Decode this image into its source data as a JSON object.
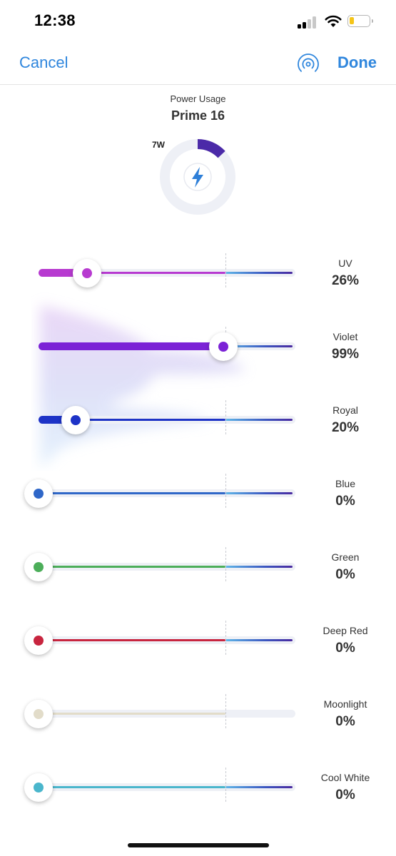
{
  "status_bar": {
    "time": "12:38"
  },
  "nav": {
    "cancel_label": "Cancel",
    "done_label": "Done",
    "broadcast_icon": "broadcast-icon"
  },
  "power": {
    "caption": "Power Usage",
    "device": "Prime 16",
    "watts_label": "7W",
    "ring_fraction": 0.13
  },
  "colors": {
    "accent": "#2f86dd",
    "ring_fill": "#4b2aa8",
    "ring_track": "#eef0f6"
  },
  "channels": [
    {
      "name": "UV",
      "value_label": "26%",
      "level": 0.26,
      "color": "#b73ad0"
    },
    {
      "name": "Violet",
      "value_label": "99%",
      "level": 0.99,
      "color": "#7b22d6"
    },
    {
      "name": "Royal",
      "value_label": "20%",
      "level": 0.2,
      "color": "#1d33c7"
    },
    {
      "name": "Blue",
      "value_label": "0%",
      "level": 0,
      "color": "#2f67c8"
    },
    {
      "name": "Green",
      "value_label": "0%",
      "level": 0,
      "color": "#4cae5a"
    },
    {
      "name": "Deep Red",
      "value_label": "0%",
      "level": 0,
      "color": "#c8253f"
    },
    {
      "name": "Moonlight",
      "value_label": "0%",
      "level": 0,
      "color": "#e2dcc9"
    },
    {
      "name": "Cool White",
      "value_label": "0%",
      "level": 0,
      "color": "#4ab6cc"
    }
  ]
}
